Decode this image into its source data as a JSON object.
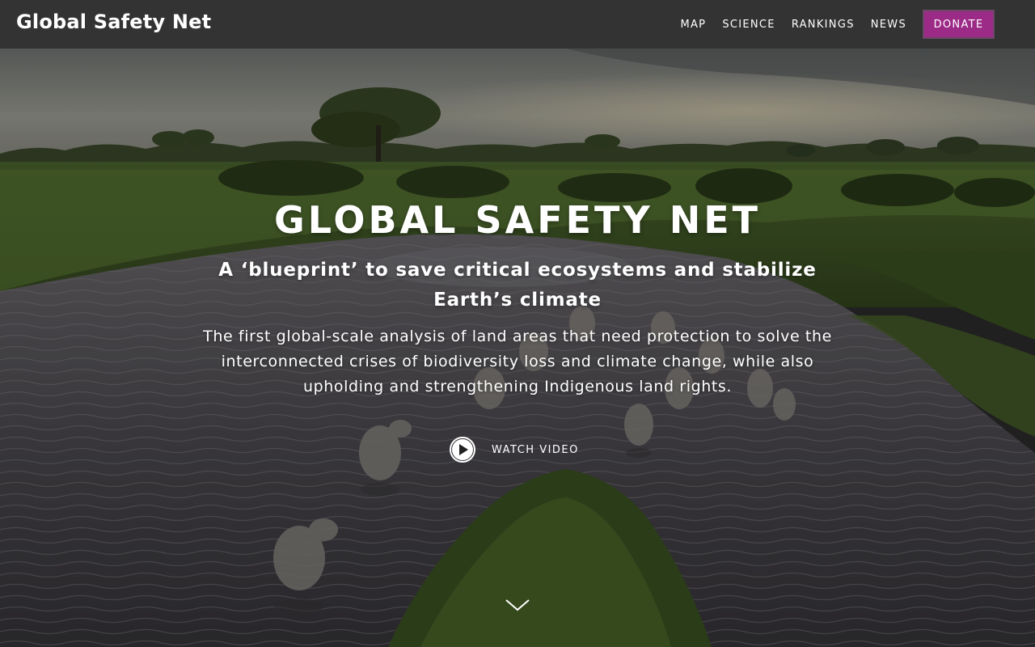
{
  "header": {
    "brand": "Global Safety Net",
    "nav": [
      "MAP",
      "SCIENCE",
      "RANKINGS",
      "NEWS"
    ],
    "donate_label": "DONATE"
  },
  "hero": {
    "title": "GLOBAL SAFETY NET",
    "subtitle": "A ‘blueprint’ to save critical ecosystems and stabilize Earth’s climate",
    "description": "The first global-scale analysis of land areas that need protection to solve the interconnected crises of biodiversity loss and climate change, while also upholding and strengthening Indigenous land rights.",
    "watch_label": "WATCH VIDEO",
    "play_icon": "play-circle-icon",
    "scroll_icon": "chevron-down-icon",
    "background": "aerial photo of elephants crossing a river in green wetlands"
  },
  "colors": {
    "header_bg": "#333333",
    "donate_bg": "#9c2a87",
    "text": "#ffffff"
  }
}
